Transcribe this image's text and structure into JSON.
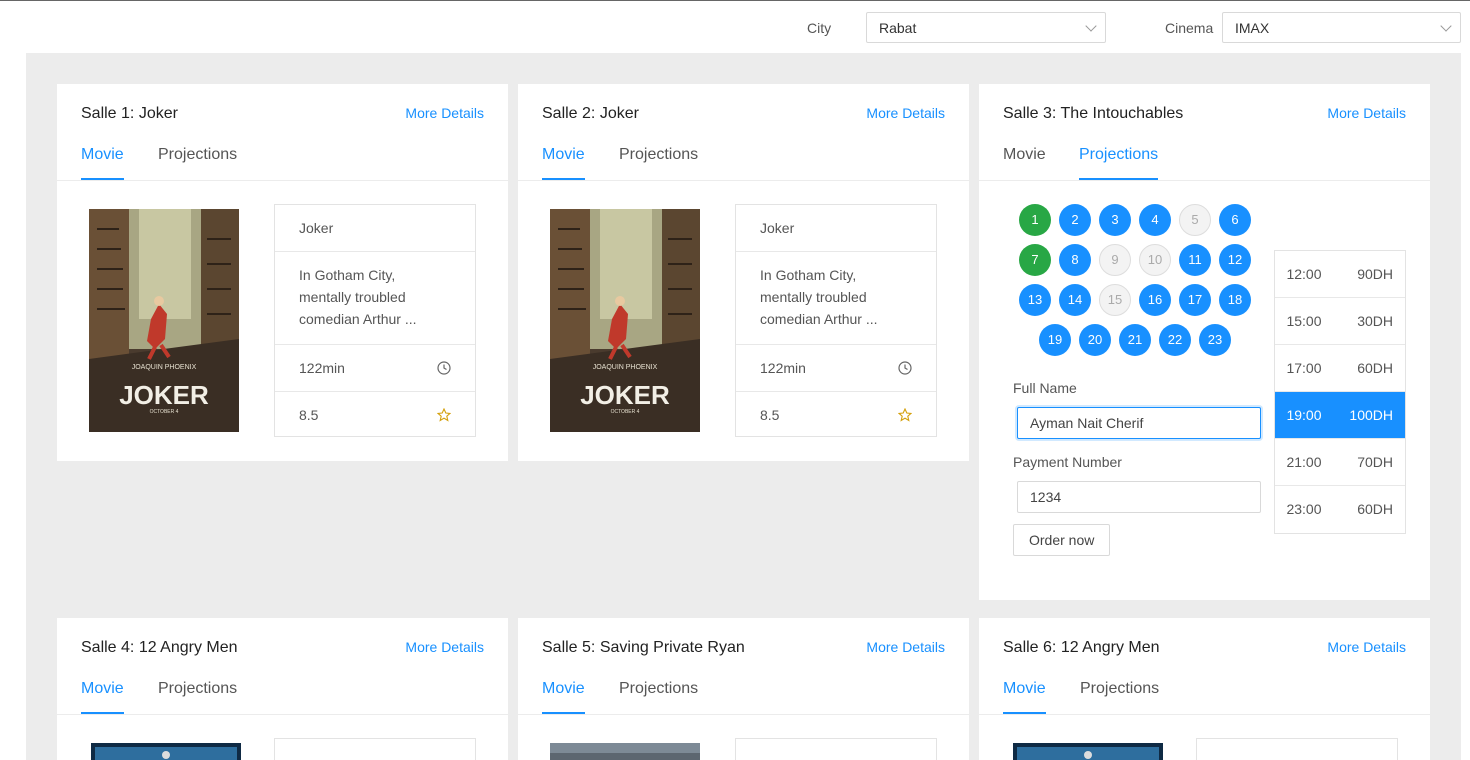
{
  "filters": {
    "city_label": "City",
    "city_value": "Rabat",
    "cinema_label": "Cinema",
    "cinema_value": "IMAX"
  },
  "colors": {
    "accent": "#1890ff",
    "reserved": "#28a745",
    "background": "#ececec"
  },
  "common": {
    "more_details": "More Details",
    "tab_movie": "Movie",
    "tab_projections": "Projections"
  },
  "salles": [
    {
      "title": "Salle 1: Joker",
      "active_tab": "Movie",
      "movie": {
        "name": "Joker",
        "description": "In Gotham City, mentally troubled comedian Arthur ...",
        "duration": "122min",
        "rating": "8.5"
      }
    },
    {
      "title": "Salle 2: Joker",
      "active_tab": "Movie",
      "movie": {
        "name": "Joker",
        "description": "In Gotham City, mentally troubled comedian Arthur ...",
        "duration": "122min",
        "rating": "8.5"
      }
    },
    {
      "title": "Salle 3: The Intouchables",
      "active_tab": "Projections"
    },
    {
      "title": "Salle 4: 12 Angry Men",
      "active_tab": "Movie"
    },
    {
      "title": "Salle 5: Saving Private Ryan",
      "active_tab": "Movie"
    },
    {
      "title": "Salle 6: 12 Angry Men",
      "active_tab": "Movie"
    }
  ],
  "poster_text": {
    "actor": "JOAQUIN PHOENIX",
    "title": "JOKER",
    "date": "OCTOBER 4"
  },
  "booking": {
    "seats": [
      {
        "n": "1",
        "state": "reserved"
      },
      {
        "n": "2",
        "state": "free"
      },
      {
        "n": "3",
        "state": "free"
      },
      {
        "n": "4",
        "state": "free"
      },
      {
        "n": "5",
        "state": "taken"
      },
      {
        "n": "6",
        "state": "free"
      },
      {
        "n": "7",
        "state": "reserved"
      },
      {
        "n": "8",
        "state": "free"
      },
      {
        "n": "9",
        "state": "taken"
      },
      {
        "n": "10",
        "state": "taken"
      },
      {
        "n": "11",
        "state": "free"
      },
      {
        "n": "12",
        "state": "free"
      },
      {
        "n": "13",
        "state": "free"
      },
      {
        "n": "14",
        "state": "free"
      },
      {
        "n": "15",
        "state": "taken"
      },
      {
        "n": "16",
        "state": "free"
      },
      {
        "n": "17",
        "state": "free"
      },
      {
        "n": "18",
        "state": "free"
      },
      {
        "n": "19",
        "state": "free"
      },
      {
        "n": "20",
        "state": "free"
      },
      {
        "n": "21",
        "state": "free"
      },
      {
        "n": "22",
        "state": "free"
      },
      {
        "n": "23",
        "state": "free"
      }
    ],
    "full_name_label": "Full Name",
    "full_name_value": "Ayman Nait Cherif",
    "payment_label": "Payment Number",
    "payment_value": "1234",
    "order_button": "Order now",
    "projections": [
      {
        "time": "12:00",
        "price": "90DH",
        "selected": false
      },
      {
        "time": "15:00",
        "price": "30DH",
        "selected": false
      },
      {
        "time": "17:00",
        "price": "60DH",
        "selected": false
      },
      {
        "time": "19:00",
        "price": "100DH",
        "selected": true
      },
      {
        "time": "21:00",
        "price": "70DH",
        "selected": false
      },
      {
        "time": "23:00",
        "price": "60DH",
        "selected": false
      }
    ]
  }
}
